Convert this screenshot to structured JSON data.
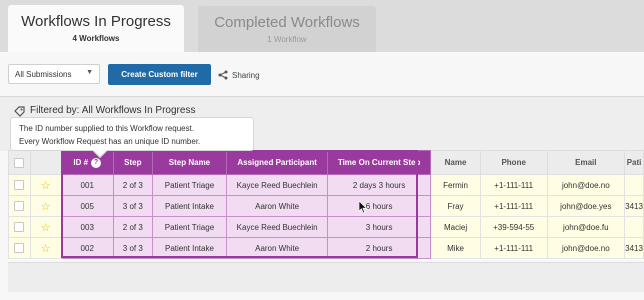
{
  "tabs": [
    {
      "title": "Workflows In Progress",
      "subtitle": "4 Workflows"
    },
    {
      "title": "Completed Workflows",
      "subtitle": "1 Workflow"
    }
  ],
  "toolbar": {
    "submissions_select": "All Submissions",
    "create_filter_label": "Create Custom filter",
    "share_label": "Sharing"
  },
  "filter": {
    "label": "Filtered by:",
    "value": "All Workflows In Progress"
  },
  "tooltip": {
    "line1": "The ID number supplied to this Workflow request.",
    "line2": "Every Workflow Request has an unique ID number."
  },
  "table": {
    "columns": [
      "ID #",
      "Step",
      "Step Name",
      "Assigned Participant",
      "Time On Current Step",
      "Name",
      "Phone",
      "Email",
      "Pati"
    ],
    "rows": [
      {
        "id": "001",
        "step": "2 of 3",
        "step_name": "Patient Triage",
        "participant": "Kayce Reed Buechlein",
        "time": "2 days 3 hours",
        "name": "Fermin",
        "phone": "+1-111-111",
        "email": "john@doe.no",
        "extra": ""
      },
      {
        "id": "005",
        "step": "3 of 3",
        "step_name": "Patient Intake",
        "participant": "Aaron White",
        "time": "6 hours",
        "name": "Fray",
        "phone": "+1-111-111",
        "email": "john@doe.yes",
        "extra": "3413"
      },
      {
        "id": "003",
        "step": "2 of 3",
        "step_name": "Patient Triage",
        "participant": "Kayce Reed Buechlein",
        "time": "3 hours",
        "name": "Maciej",
        "phone": "+39-594-55",
        "email": "john@doe.fu",
        "extra": ""
      },
      {
        "id": "002",
        "step": "3 of 3",
        "step_name": "Patient Intake",
        "participant": "Aaron White",
        "time": "2 hours",
        "name": "Mike",
        "phone": "+1-111-111",
        "email": "john@doe.no",
        "extra": "3413"
      }
    ]
  },
  "colors": {
    "accent_purple": "#9a3a9e",
    "highlight_cell": "#f1dcf2",
    "button_blue": "#1f6aa7",
    "star": "#e9b800"
  }
}
